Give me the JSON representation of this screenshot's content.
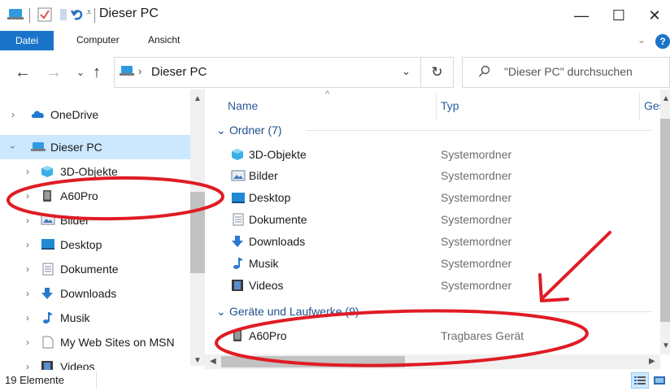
{
  "window": {
    "title": "Dieser PC",
    "minimize": "—",
    "maximize": "☐",
    "close": "✕"
  },
  "ribbon": {
    "tabs": [
      "Datei",
      "Computer",
      "Ansicht"
    ],
    "help": "?",
    "collapse": "⌄"
  },
  "address": {
    "path": "Dieser PC",
    "search_placeholder": "\"Dieser PC\" durchsuchen"
  },
  "nav_pane": {
    "items": [
      {
        "label": "OneDrive",
        "icon": "cloud-icon"
      },
      {
        "label": "Dieser PC",
        "icon": "computer-icon",
        "selected": true
      },
      {
        "label": "3D-Objekte",
        "icon": "cube-icon"
      },
      {
        "label": "A60Pro",
        "icon": "phone-icon"
      },
      {
        "label": "Bilder",
        "icon": "pictures-icon"
      },
      {
        "label": "Desktop",
        "icon": "desktop-icon"
      },
      {
        "label": "Dokumente",
        "icon": "document-icon"
      },
      {
        "label": "Downloads",
        "icon": "download-icon"
      },
      {
        "label": "Musik",
        "icon": "music-icon"
      },
      {
        "label": "My Web Sites on MSN",
        "icon": "page-icon"
      },
      {
        "label": "Videos",
        "icon": "film-icon"
      }
    ]
  },
  "columns": {
    "name": "Name",
    "type": "Typ",
    "size": "Ges"
  },
  "groups": {
    "folders": {
      "title": "Ordner (7)",
      "rows": [
        {
          "name": "3D-Objekte",
          "type": "Systemordner",
          "icon": "cube-icon"
        },
        {
          "name": "Bilder",
          "type": "Systemordner",
          "icon": "pictures-icon"
        },
        {
          "name": "Desktop",
          "type": "Systemordner",
          "icon": "desktop-icon"
        },
        {
          "name": "Dokumente",
          "type": "Systemordner",
          "icon": "document-icon"
        },
        {
          "name": "Downloads",
          "type": "Systemordner",
          "icon": "download-icon"
        },
        {
          "name": "Musik",
          "type": "Systemordner",
          "icon": "music-icon"
        },
        {
          "name": "Videos",
          "type": "Systemordner",
          "icon": "film-icon"
        }
      ]
    },
    "devices": {
      "title": "Geräte und Laufwerke (9)",
      "rows": [
        {
          "name": "A60Pro",
          "type": "Tragbares Gerät",
          "icon": "phone-icon"
        }
      ]
    }
  },
  "status": {
    "count": "19 Elemente"
  },
  "colors": {
    "accent": "#1a73c9",
    "selection": "#cce8ff",
    "annotation": "#e01b24"
  }
}
